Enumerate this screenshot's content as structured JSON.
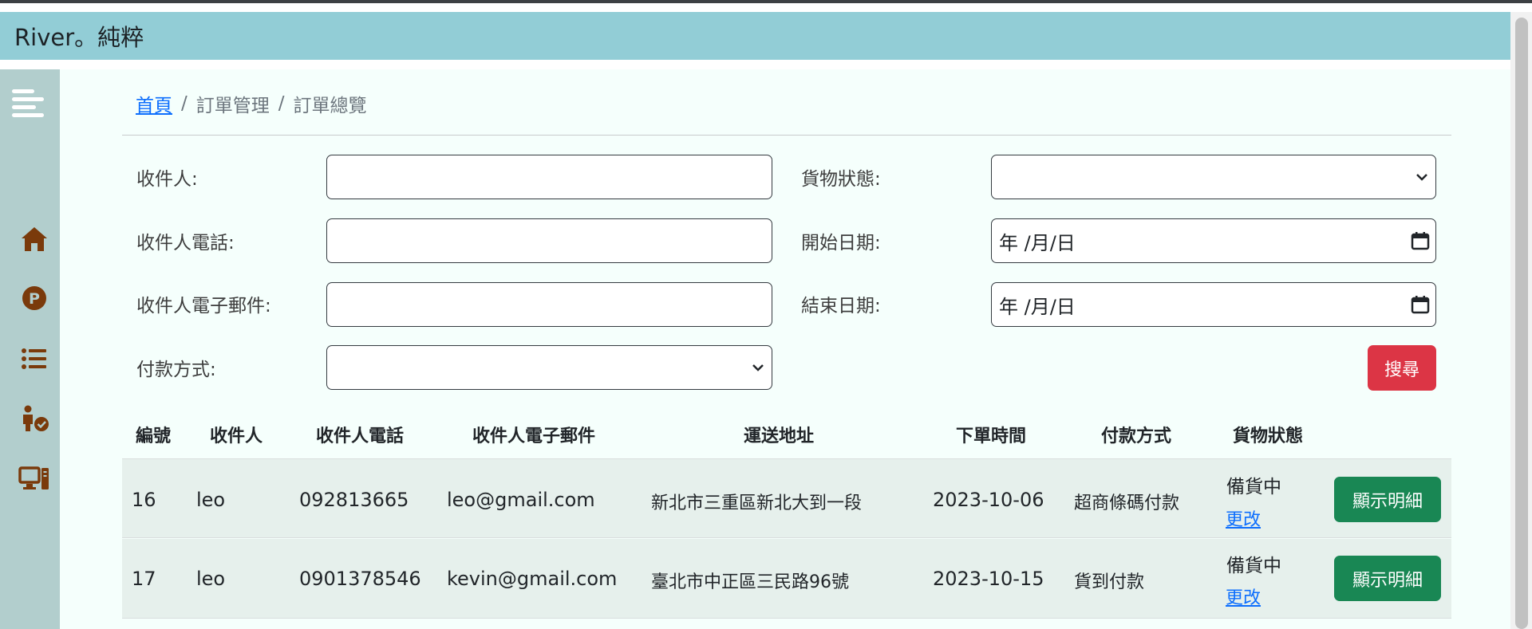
{
  "app": {
    "brand": "River。純粹"
  },
  "breadcrumb": {
    "home": "首頁",
    "separator": "/",
    "level2": "訂單管理",
    "level3": "訂單總覽"
  },
  "filters": {
    "recipient_label": "收件人:",
    "recipient_value": "",
    "phone_label": "收件人電話:",
    "phone_value": "",
    "email_label": "收件人電子郵件:",
    "email_value": "",
    "payment_label": "付款方式:",
    "payment_selected": "",
    "status_label": "貨物狀態:",
    "status_selected": "",
    "start_date_label": "開始日期:",
    "start_date_value": "年 /月/日",
    "end_date_label": "結束日期:",
    "end_date_value": "年 /月/日",
    "search_button": "搜尋"
  },
  "table": {
    "headers": [
      "編號",
      "收件人",
      "收件人電話",
      "收件人電子郵件",
      "運送地址",
      "下單時間",
      "付款方式",
      "貨物狀態"
    ],
    "rows": [
      {
        "id": "16",
        "recipient": "leo",
        "phone": "092813665",
        "email": "leo@gmail.com",
        "address": "新北市三重區新北大到一段",
        "order_date": "2023-10-06",
        "payment": "超商條碼付款",
        "status": "備貨中",
        "change_link": "更改",
        "detail_button": "顯示明細"
      },
      {
        "id": "17",
        "recipient": "leo",
        "phone": "0901378546",
        "email": "kevin@gmail.com",
        "address": "臺北市中正區三民路96號",
        "order_date": "2023-10-15",
        "payment": "貨到付款",
        "status": "備貨中",
        "change_link": "更改",
        "detail_button": "顯示明細"
      }
    ]
  },
  "sidebar": {
    "icons": [
      "menu-icon",
      "home-icon",
      "points-icon",
      "list-icon",
      "person-check-icon",
      "computer-icon"
    ]
  },
  "colors": {
    "header": "#92cdd6",
    "sidebar": "#b2cecd",
    "main_bg": "#f5fffc",
    "icon": "#7a3a0b",
    "search_button": "#dc3545",
    "detail_button": "#198754",
    "link": "#0d6efd"
  }
}
